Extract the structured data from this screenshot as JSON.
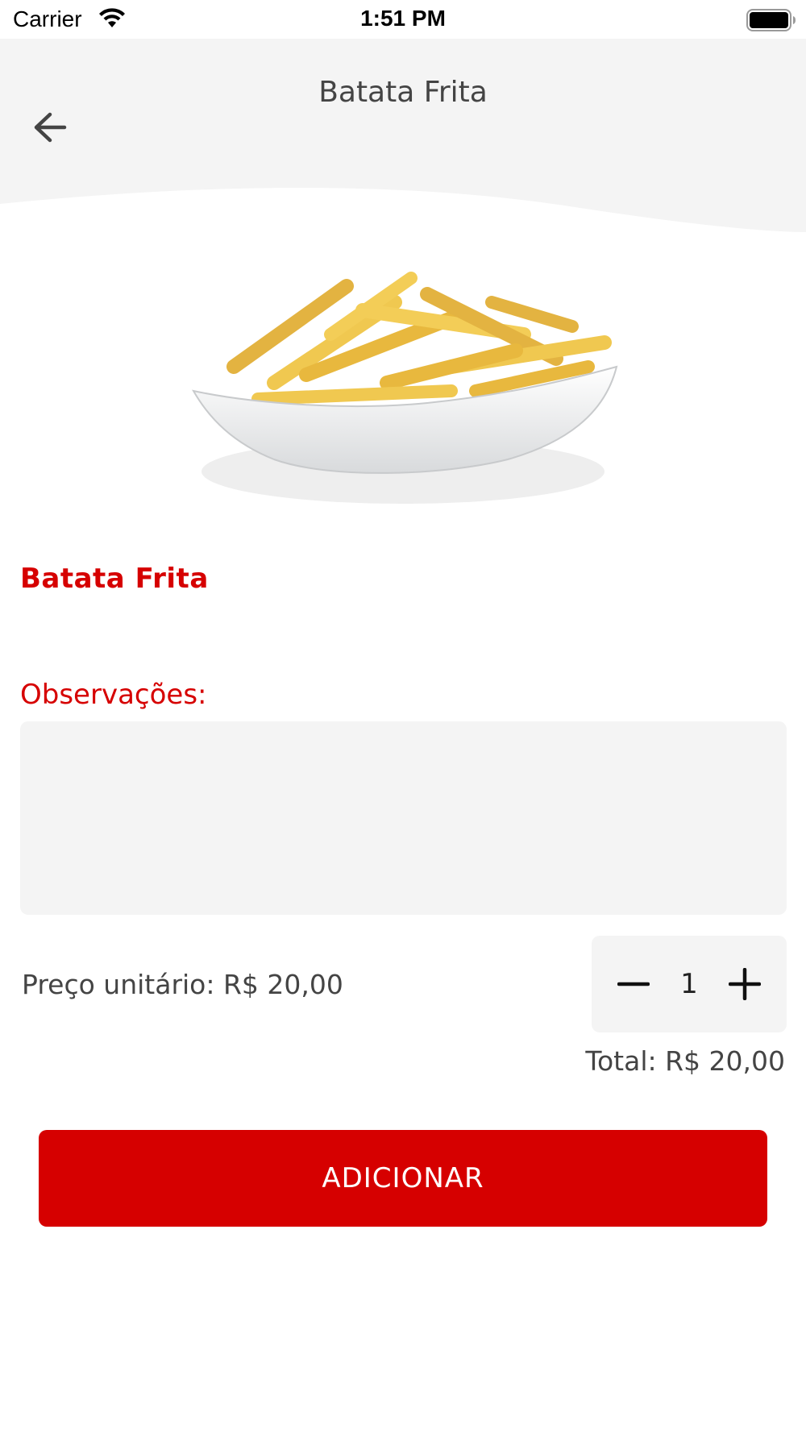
{
  "status_bar": {
    "carrier": "Carrier",
    "time": "1:51 PM",
    "wifi_icon": "wifi-icon",
    "battery_icon": "battery-icon"
  },
  "header": {
    "title": "Batata Frita",
    "back_icon": "arrow-left-icon"
  },
  "product": {
    "name": "Batata Frita",
    "image": "french-fries-photo"
  },
  "observations": {
    "label": "Observações:",
    "value": ""
  },
  "pricing": {
    "unit_price": "Preço unitário: R$ 20,00",
    "quantity": "1",
    "total": "Total: R$ 20,00",
    "minus_icon": "minus-icon",
    "plus_icon": "plus-icon"
  },
  "actions": {
    "add_label": "ADICIONAR"
  },
  "colors": {
    "accent": "#d60000",
    "surface": "#f4f4f4",
    "text": "#444444"
  }
}
